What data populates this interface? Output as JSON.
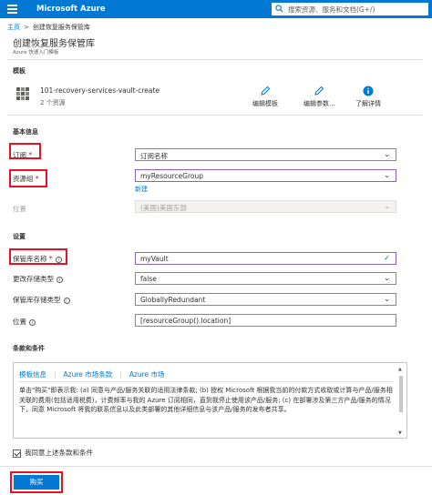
{
  "topbar": {
    "brand": "Microsoft Azure",
    "search_placeholder": "搜索资源、服务和文档(G+/)"
  },
  "breadcrumb": {
    "home": "主页",
    "separator": ">",
    "current": "创建恢复服务保管库"
  },
  "page": {
    "title": "创建恢复服务保管库",
    "subtitle": "Azure 快速入门模板"
  },
  "template": {
    "section": "模板",
    "name": "101-recovery-services-vault-create",
    "count": "2 个资源",
    "edit_template": "编辑模板",
    "edit_params": "编辑参数...",
    "learn_more": "了解详情"
  },
  "basics": {
    "section": "基本信息",
    "subscription_label": "订阅",
    "subscription_value": "订阅名称",
    "resource_group_label": "资源组",
    "resource_group_value": "myResourceGroup",
    "new_link": "新建",
    "location_label": "位置",
    "location_value": "(美国)美国东部"
  },
  "settings": {
    "section": "设置",
    "vault_name_label": "保管库名称",
    "vault_name_value": "myVault",
    "change_storage_label": "更改存储类型",
    "change_storage_value": "false",
    "storage_type_label": "保管库存储类型",
    "storage_type_value": "GloballyRedundant",
    "location_label": "位置",
    "location_value": "[resourceGroup().location]"
  },
  "terms": {
    "section": "条款和条件",
    "tabs": [
      "模板信息",
      "Azure 市场条款",
      "Azure 市场"
    ],
    "text": "单击\"购买\"即表示我: (a) 同意与产品/服务关联的适用法律条款; (b) 授权 Microsoft 根据我当前的付款方式收取或计算与产品/服务相关联的费用(包括适用税费)，计费频率与我的 Azure 订阅相同，直到我停止使用该产品/服务; (c) 在部署涉及第三方产品/服务的情况下，同意 Microsoft 将我的联系信息以及此类部署的其他详细信息与该产品/服务的发布者共享。",
    "agree_label": "我同意上述条款和条件"
  },
  "footer": {
    "buy_label": "购买"
  },
  "required_mark": "*",
  "colors": {
    "azure_blue": "#0078d4",
    "highlight_red": "#e81123",
    "focus_purple": "#8661c5"
  }
}
